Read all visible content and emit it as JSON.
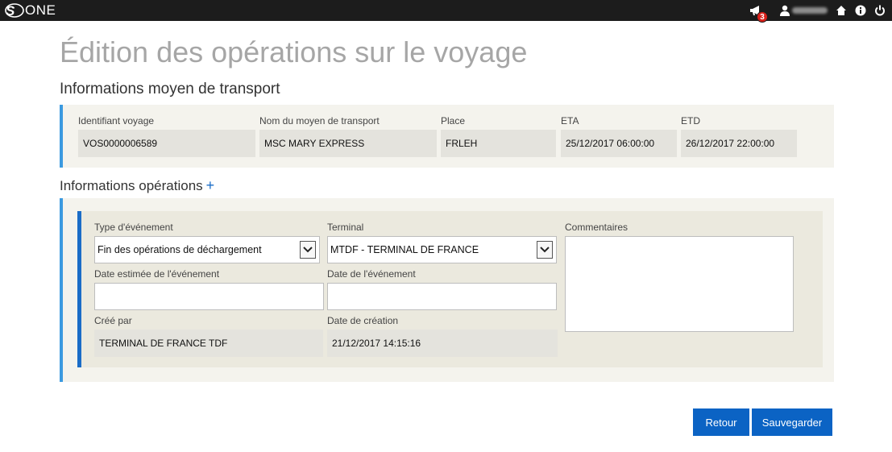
{
  "brand": {
    "logo_letter": "S",
    "name": "ONE"
  },
  "topbar": {
    "notification_count": "3",
    "icons": [
      "megaphone-icon",
      "user-icon",
      "home-icon",
      "info-icon",
      "power-icon"
    ]
  },
  "page": {
    "title": "Édition des opérations sur le voyage"
  },
  "transport": {
    "title": "Informations moyen de transport",
    "fields": {
      "voyage_id": {
        "label": "Identifiant voyage",
        "value": "VOS0000006589"
      },
      "vessel": {
        "label": "Nom du moyen de transport",
        "value": "MSC MARY EXPRESS"
      },
      "place": {
        "label": "Place",
        "value": "FRLEH"
      },
      "eta": {
        "label": "ETA",
        "value": "25/12/2017 06:00:00"
      },
      "etd": {
        "label": "ETD",
        "value": "26/12/2017 22:00:00"
      }
    }
  },
  "operations": {
    "title": "Informations opérations",
    "add_symbol": "+",
    "event_type": {
      "label": "Type d'événement",
      "value": "Fin des opérations de déchargement"
    },
    "terminal": {
      "label": "Terminal",
      "value": "MTDF - TERMINAL DE FRANCE"
    },
    "comments": {
      "label": "Commentaires",
      "value": ""
    },
    "estimated_date": {
      "label": "Date estimée de l'événement",
      "value": ""
    },
    "event_date": {
      "label": "Date de l'événement",
      "value": ""
    },
    "created_by": {
      "label": "Créé par",
      "value": "TERMINAL DE FRANCE TDF"
    },
    "creation_date": {
      "label": "Date de création",
      "value": "21/12/2017 14:15:16"
    }
  },
  "actions": {
    "back_label": "Retour",
    "save_label": "Sauvegarder"
  },
  "colors": {
    "accent": "#0b63c4",
    "border_accent": "#3b9ae0",
    "topbar": "#1c1c1c",
    "badge": "#d9211b"
  }
}
